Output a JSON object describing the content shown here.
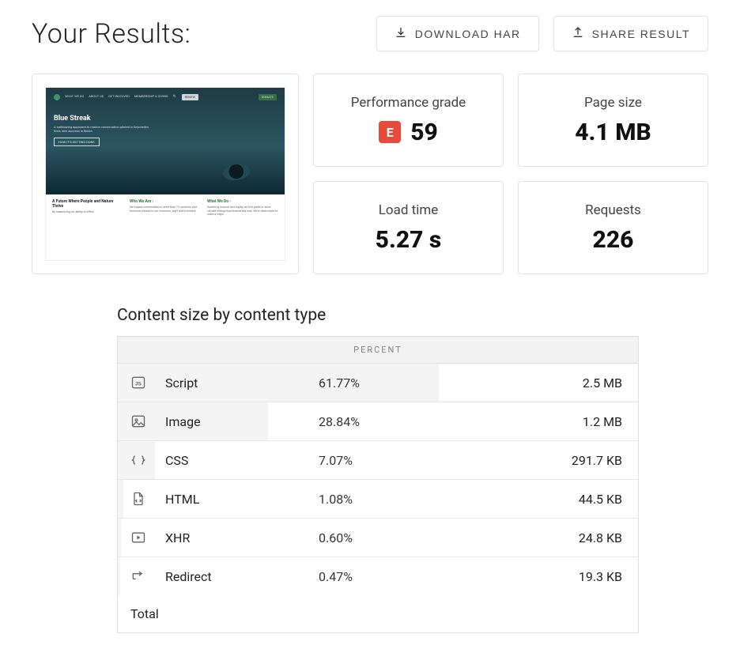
{
  "header": {
    "title": "Your Results:",
    "download_label": "DOWNLOAD HAR",
    "share_label": "SHARE RESULT"
  },
  "screenshot": {
    "hero_title": "Blue Streak",
    "hero_sub": "A trailblazing approach to marine conservation piloted in Seychelles finds new success in Belize.",
    "hero_btn": "HOW IT'S GETTING DONE",
    "col1_title": "A Future Where People and Nature Thrive",
    "col1_body": "By maximizing our ability to effect",
    "col2_title": "Who We Are ›",
    "col2_body": "We impact conservation in more than 70 countries and territories thanks to our members, staff and scientists.",
    "col3_title": "What We Do ›",
    "col3_body": "Guided by science and equity, we find paths to solve climate change and biodiversity loss. We're determined to make a major"
  },
  "metrics": {
    "perf_label": "Performance grade",
    "grade_letter": "E",
    "grade_value": "59",
    "page_size_label": "Page size",
    "page_size_value": "4.1 MB",
    "load_time_label": "Load time",
    "load_time_value": "5.27 s",
    "requests_label": "Requests",
    "requests_value": "226"
  },
  "content_table": {
    "title": "Content size by content type",
    "header": "PERCENT",
    "rows": [
      {
        "icon": "js",
        "name": "Script",
        "percent": "61.77%",
        "size": "2.5 MB",
        "bar": 61.77
      },
      {
        "icon": "image",
        "name": "Image",
        "percent": "28.84%",
        "size": "1.2 MB",
        "bar": 28.84
      },
      {
        "icon": "css",
        "name": "CSS",
        "percent": "7.07%",
        "size": "291.7 KB",
        "bar": 7.07
      },
      {
        "icon": "html",
        "name": "HTML",
        "percent": "1.08%",
        "size": "44.5 KB",
        "bar": 1.08
      },
      {
        "icon": "xhr",
        "name": "XHR",
        "percent": "0.60%",
        "size": "24.8 KB",
        "bar": 0.6
      },
      {
        "icon": "redirect",
        "name": "Redirect",
        "percent": "0.47%",
        "size": "19.3 KB",
        "bar": 0.47
      }
    ],
    "total_label": "Total"
  }
}
